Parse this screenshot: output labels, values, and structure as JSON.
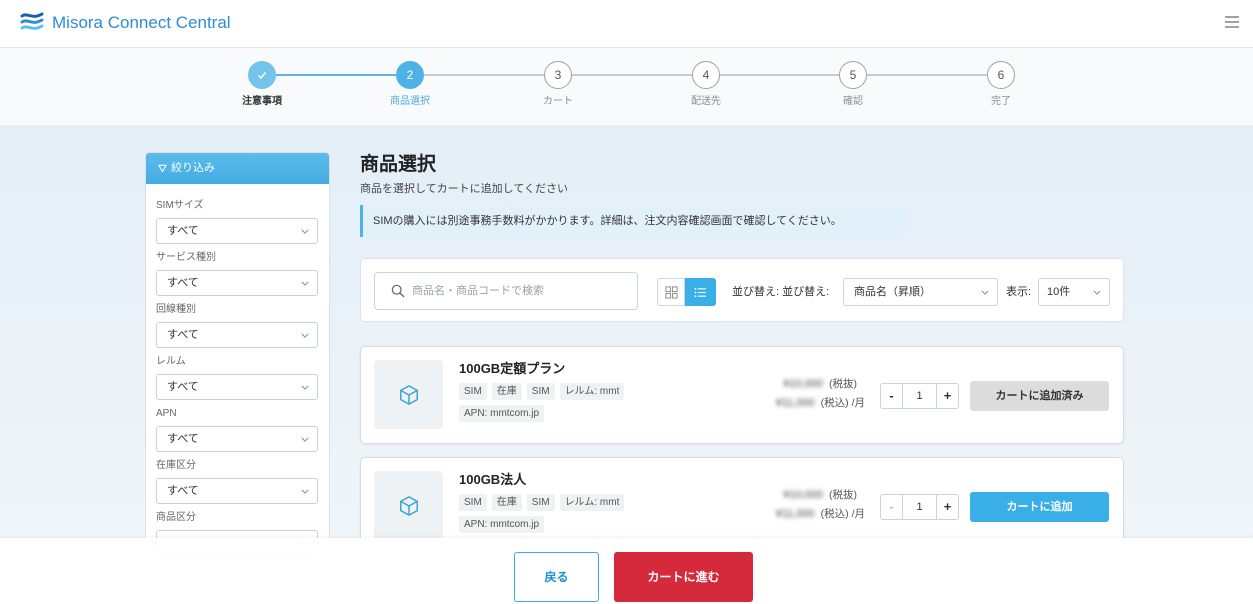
{
  "header": {
    "brand": "Misora Connect Central",
    "logo_icon": "wave-stripes-icon",
    "menu_icon": "hamburger-icon"
  },
  "stepper": {
    "steps": [
      {
        "icon": "check-icon",
        "label": "注意事項",
        "completed": true,
        "current": false
      },
      {
        "number": "2",
        "label": "商品選択",
        "completed": false,
        "current": true
      },
      {
        "number": "3",
        "label": "カート",
        "completed": false,
        "current": false
      },
      {
        "number": "4",
        "label": "配送先",
        "completed": false,
        "current": false
      },
      {
        "number": "5",
        "label": "確認",
        "completed": false,
        "current": false
      },
      {
        "number": "6",
        "label": "完了",
        "completed": false,
        "current": false
      }
    ]
  },
  "filter": {
    "icon": "filter-icon",
    "title": "絞り込み",
    "fields": [
      {
        "label": "SIMサイズ",
        "value": "すべて"
      },
      {
        "label": "サービス種別",
        "value": "すべて"
      },
      {
        "label": "回線種別",
        "value": "すべて"
      },
      {
        "label": "レルム",
        "value": "すべて"
      },
      {
        "label": "APN",
        "value": "すべて"
      },
      {
        "label": "在庫区分",
        "value": "すべて"
      },
      {
        "label": "商品区分"
      }
    ]
  },
  "main": {
    "title": "商品選択",
    "subtitle": "商品を選択してカートに追加してください",
    "notice": "SIMの購入には別途事務手数料がかかります。詳細は、注文内容確認画面で確認してください。"
  },
  "toolbar": {
    "search_icon": "search-icon",
    "search_placeholder": "商品名・商品コードで検索",
    "view_modes": [
      {
        "icon": "grid-view-icon",
        "selected": false
      },
      {
        "icon": "list-view-icon",
        "selected": true
      }
    ],
    "sort_label": "並び替え: 並び替え:",
    "sort_value": "商品名（昇順）",
    "per_page_label": "表示:",
    "per_page_value": "10件"
  },
  "products": [
    {
      "image_icon": "cube-icon",
      "name": "100GB定額プラン",
      "tags": [
        "SIM",
        "在庫",
        "SIM",
        "レルム: mmt"
      ],
      "apn": "APN: mmtcom.jp",
      "price_excl": "¥10,000",
      "price_excl_note": "(税抜)",
      "price_incl": "¥11,000",
      "price_incl_note": "(税込)",
      "price_period": "/月",
      "decrement": "-",
      "quantity": "1",
      "increment": "+",
      "action_label": "カートに追加済み",
      "in_cart": true
    },
    {
      "image_icon": "cube-icon",
      "name": "100GB法人",
      "tags": [
        "SIM",
        "在庫",
        "SIM",
        "レルム: mmt"
      ],
      "apn": "APN: mmtcom.jp",
      "price_excl": "¥10,000",
      "price_excl_note": "(税抜)",
      "price_incl": "¥11,000",
      "price_incl_note": "(税込)",
      "price_period": "/月",
      "decrement": "-",
      "quantity": "1",
      "increment": "+",
      "action_label": "カートに追加",
      "in_cart": false
    }
  ],
  "footer": {
    "back_label": "戻る",
    "next_label": "カートに進む"
  },
  "colors": {
    "primary": "#3aaee6",
    "brand": "#2a8ed1",
    "danger": "#d42a3b",
    "added_button": "#dcdcdc"
  }
}
